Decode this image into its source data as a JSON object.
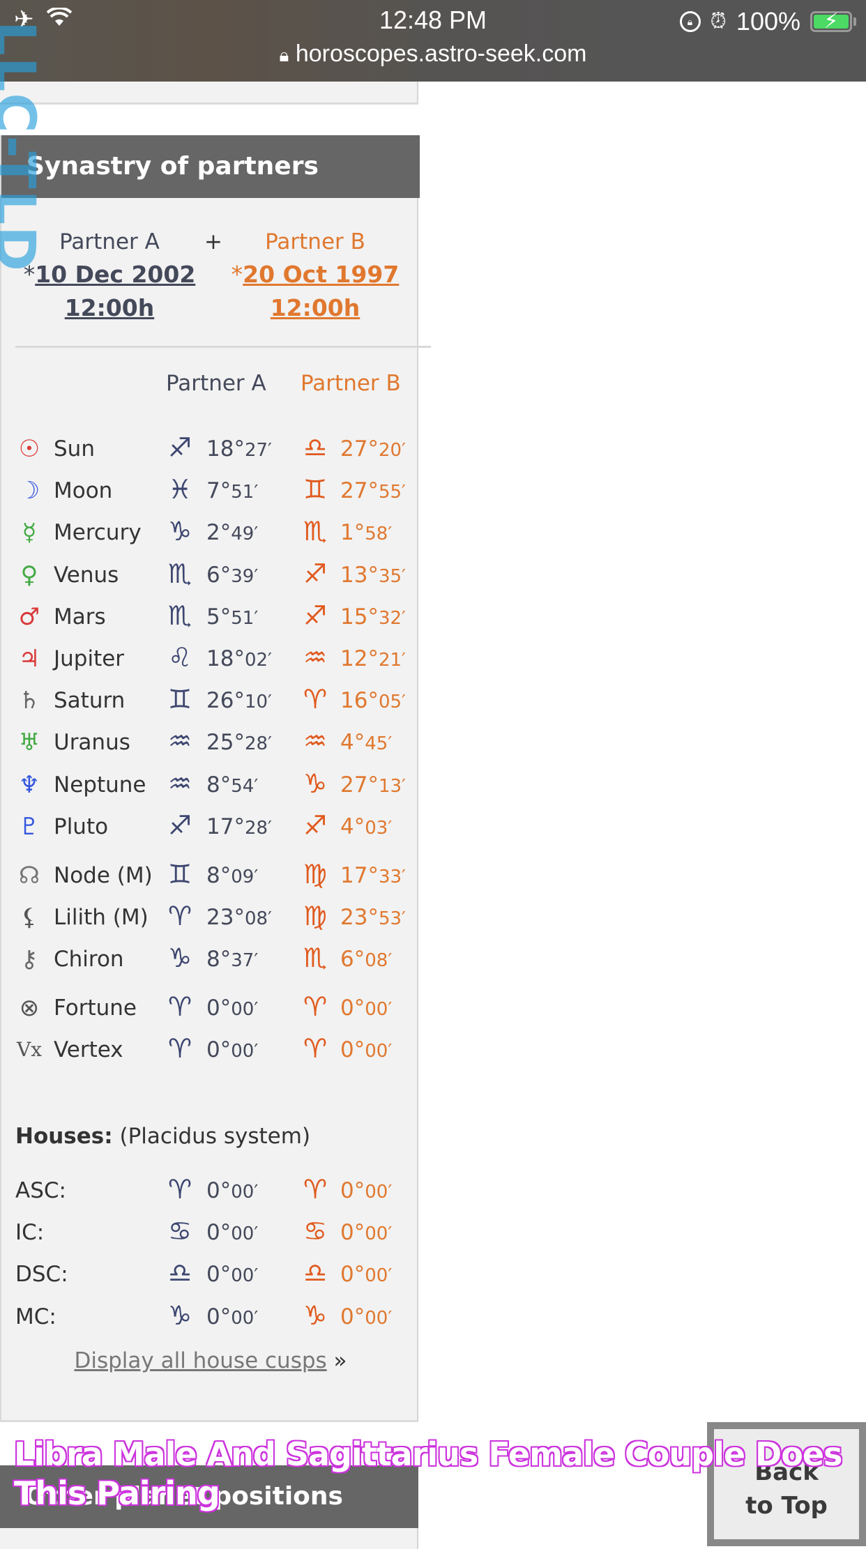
{
  "status_bar": {
    "time": "12:48 PM",
    "battery_percent": "100%",
    "battery_level": 1.0,
    "url": "horoscopes.astro-seek.com",
    "icons": [
      "airplane-icon",
      "wifi-icon",
      "rotation-lock-icon",
      "alarm-icon",
      "battery-charging-icon",
      "lock-icon"
    ]
  },
  "watermark": {
    "side_text": "LLC-TLD",
    "overlay_title": "Libra Male And Sagittarius Female Couple Does This Pairing"
  },
  "panel": {
    "title": "Synastry of partners",
    "partner_a": {
      "label": "Partner A",
      "star": "*",
      "date": "10 Dec 2002",
      "time": "12:00h",
      "color": "#44495a"
    },
    "plus": "+",
    "partner_b": {
      "label": "Partner B",
      "star": "*",
      "date": "20 Oct 1997",
      "time": "12:00h",
      "color": "#e0782f"
    },
    "column_headers": {
      "a": "Partner A",
      "b": "Partner B"
    },
    "planets": [
      {
        "name": "Sun",
        "icon": "sun-icon",
        "glyph": "☉",
        "glyph_color": "#d93a3a",
        "a_sign": "♐",
        "a_sign_name": "sagittarius-icon",
        "a_deg": "18°",
        "a_min": "27′",
        "b_sign": "♎",
        "b_sign_name": "libra-icon",
        "b_deg": "27°",
        "b_min": "20′"
      },
      {
        "name": "Moon",
        "icon": "moon-icon",
        "glyph": "☽",
        "glyph_color": "#3355dd",
        "a_sign": "♓",
        "a_sign_name": "pisces-icon",
        "a_deg": "7°",
        "a_min": "51′",
        "b_sign": "♊",
        "b_sign_name": "gemini-icon",
        "b_deg": "27°",
        "b_min": "55′"
      },
      {
        "name": "Mercury",
        "icon": "mercury-icon",
        "glyph": "☿",
        "glyph_color": "#44aa44",
        "a_sign": "♑",
        "a_sign_name": "capricorn-icon",
        "a_deg": "2°",
        "a_min": "49′",
        "b_sign": "♏",
        "b_sign_name": "scorpio-icon",
        "b_deg": "1°",
        "b_min": "58′"
      },
      {
        "name": "Venus",
        "icon": "venus-icon",
        "glyph": "♀",
        "glyph_color": "#44aa44",
        "a_sign": "♏",
        "a_sign_name": "scorpio-icon",
        "a_deg": "6°",
        "a_min": "39′",
        "b_sign": "♐",
        "b_sign_name": "sagittarius-icon",
        "b_deg": "13°",
        "b_min": "35′"
      },
      {
        "name": "Mars",
        "icon": "mars-icon",
        "glyph": "♂",
        "glyph_color": "#d93a3a",
        "a_sign": "♏",
        "a_sign_name": "scorpio-icon",
        "a_deg": "5°",
        "a_min": "51′",
        "b_sign": "♐",
        "b_sign_name": "sagittarius-icon",
        "b_deg": "15°",
        "b_min": "32′"
      },
      {
        "name": "Jupiter",
        "icon": "jupiter-icon",
        "glyph": "♃",
        "glyph_color": "#d93a3a",
        "a_sign": "♌",
        "a_sign_name": "leo-icon",
        "a_deg": "18°",
        "a_min": "02′",
        "b_sign": "♒",
        "b_sign_name": "aquarius-icon",
        "b_deg": "12°",
        "b_min": "21′"
      },
      {
        "name": "Saturn",
        "icon": "saturn-icon",
        "glyph": "♄",
        "glyph_color": "#666666",
        "a_sign": "♊",
        "a_sign_name": "gemini-icon",
        "a_deg": "26°",
        "a_min": "10′",
        "b_sign": "♈",
        "b_sign_name": "aries-icon",
        "b_deg": "16°",
        "b_min": "05′"
      },
      {
        "name": "Uranus",
        "icon": "uranus-icon",
        "glyph": "♅",
        "glyph_color": "#44aa44",
        "a_sign": "♒",
        "a_sign_name": "aquarius-icon",
        "a_deg": "25°",
        "a_min": "28′",
        "b_sign": "♒",
        "b_sign_name": "aquarius-icon",
        "b_deg": "4°",
        "b_min": "45′"
      },
      {
        "name": "Neptune",
        "icon": "neptune-icon",
        "glyph": "♆",
        "glyph_color": "#3355dd",
        "a_sign": "♒",
        "a_sign_name": "aquarius-icon",
        "a_deg": "8°",
        "a_min": "54′",
        "b_sign": "♑",
        "b_sign_name": "capricorn-icon",
        "b_deg": "27°",
        "b_min": "13′"
      },
      {
        "name": "Pluto",
        "icon": "pluto-icon",
        "glyph": "♇",
        "glyph_color": "#3355dd",
        "a_sign": "♐",
        "a_sign_name": "sagittarius-icon",
        "a_deg": "17°",
        "a_min": "28′",
        "b_sign": "♐",
        "b_sign_name": "sagittarius-icon",
        "b_deg": "4°",
        "b_min": "03′"
      }
    ],
    "points": [
      {
        "name": "Node (M)",
        "icon": "node-icon",
        "glyph": "☊",
        "glyph_color": "#777777",
        "a_sign": "♊",
        "a_sign_name": "gemini-icon",
        "a_deg": "8°",
        "a_min": "09′",
        "b_sign": "♍",
        "b_sign_name": "virgo-icon",
        "b_deg": "17°",
        "b_min": "33′"
      },
      {
        "name": "Lilith (M)",
        "icon": "lilith-icon",
        "glyph": "⚸",
        "glyph_color": "#555555",
        "a_sign": "♈",
        "a_sign_name": "aries-icon",
        "a_deg": "23°",
        "a_min": "08′",
        "b_sign": "♍",
        "b_sign_name": "virgo-icon",
        "b_deg": "23°",
        "b_min": "53′"
      },
      {
        "name": "Chiron",
        "icon": "chiron-icon",
        "glyph": "⚷",
        "glyph_color": "#666666",
        "a_sign": "♑",
        "a_sign_name": "capricorn-icon",
        "a_deg": "8°",
        "a_min": "37′",
        "b_sign": "♏",
        "b_sign_name": "scorpio-icon",
        "b_deg": "6°",
        "b_min": "08′"
      }
    ],
    "extras": [
      {
        "name": "Fortune",
        "icon": "fortune-icon",
        "glyph": "⊗",
        "glyph_color": "#555555",
        "a_sign": "♈",
        "a_sign_name": "aries-icon",
        "a_deg": "0°",
        "a_min": "00′",
        "b_sign": "♈",
        "b_sign_name": "aries-icon",
        "b_deg": "0°",
        "b_min": "00′"
      },
      {
        "name": "Vertex",
        "icon": "vertex-icon",
        "glyph": "Vx",
        "glyph_color": "#555555",
        "a_sign": "♈",
        "a_sign_name": "aries-icon",
        "a_deg": "0°",
        "a_min": "00′",
        "b_sign": "♈",
        "b_sign_name": "aries-icon",
        "b_deg": "0°",
        "b_min": "00′"
      }
    ],
    "houses": {
      "title": "Houses:",
      "system": "(Placidus system)",
      "rows": [
        {
          "label": "ASC:",
          "a_sign": "♈",
          "a_sign_name": "aries-icon",
          "a_deg": "0°",
          "a_min": "00′",
          "b_sign": "♈",
          "b_sign_name": "aries-icon",
          "b_deg": "0°",
          "b_min": "00′"
        },
        {
          "label": "IC:",
          "a_sign": "♋",
          "a_sign_name": "cancer-icon",
          "a_deg": "0°",
          "a_min": "00′",
          "b_sign": "♋",
          "b_sign_name": "cancer-icon",
          "b_deg": "0°",
          "b_min": "00′"
        },
        {
          "label": "DSC:",
          "a_sign": "♎",
          "a_sign_name": "libra-icon",
          "a_deg": "0°",
          "a_min": "00′",
          "b_sign": "♎",
          "b_sign_name": "libra-icon",
          "b_deg": "0°",
          "b_min": "00′"
        },
        {
          "label": "MC:",
          "a_sign": "♑",
          "a_sign_name": "capricorn-icon",
          "a_deg": "0°",
          "a_min": "00′",
          "b_sign": "♑",
          "b_sign_name": "capricorn-icon",
          "b_deg": "0°",
          "b_min": "00′"
        }
      ]
    },
    "cusps_link": "Display all house cusps",
    "cusps_arrow": "»"
  },
  "next_section": {
    "title": "Other planet positions"
  },
  "back_to_top": {
    "line1": "Back",
    "line2": "to Top"
  }
}
